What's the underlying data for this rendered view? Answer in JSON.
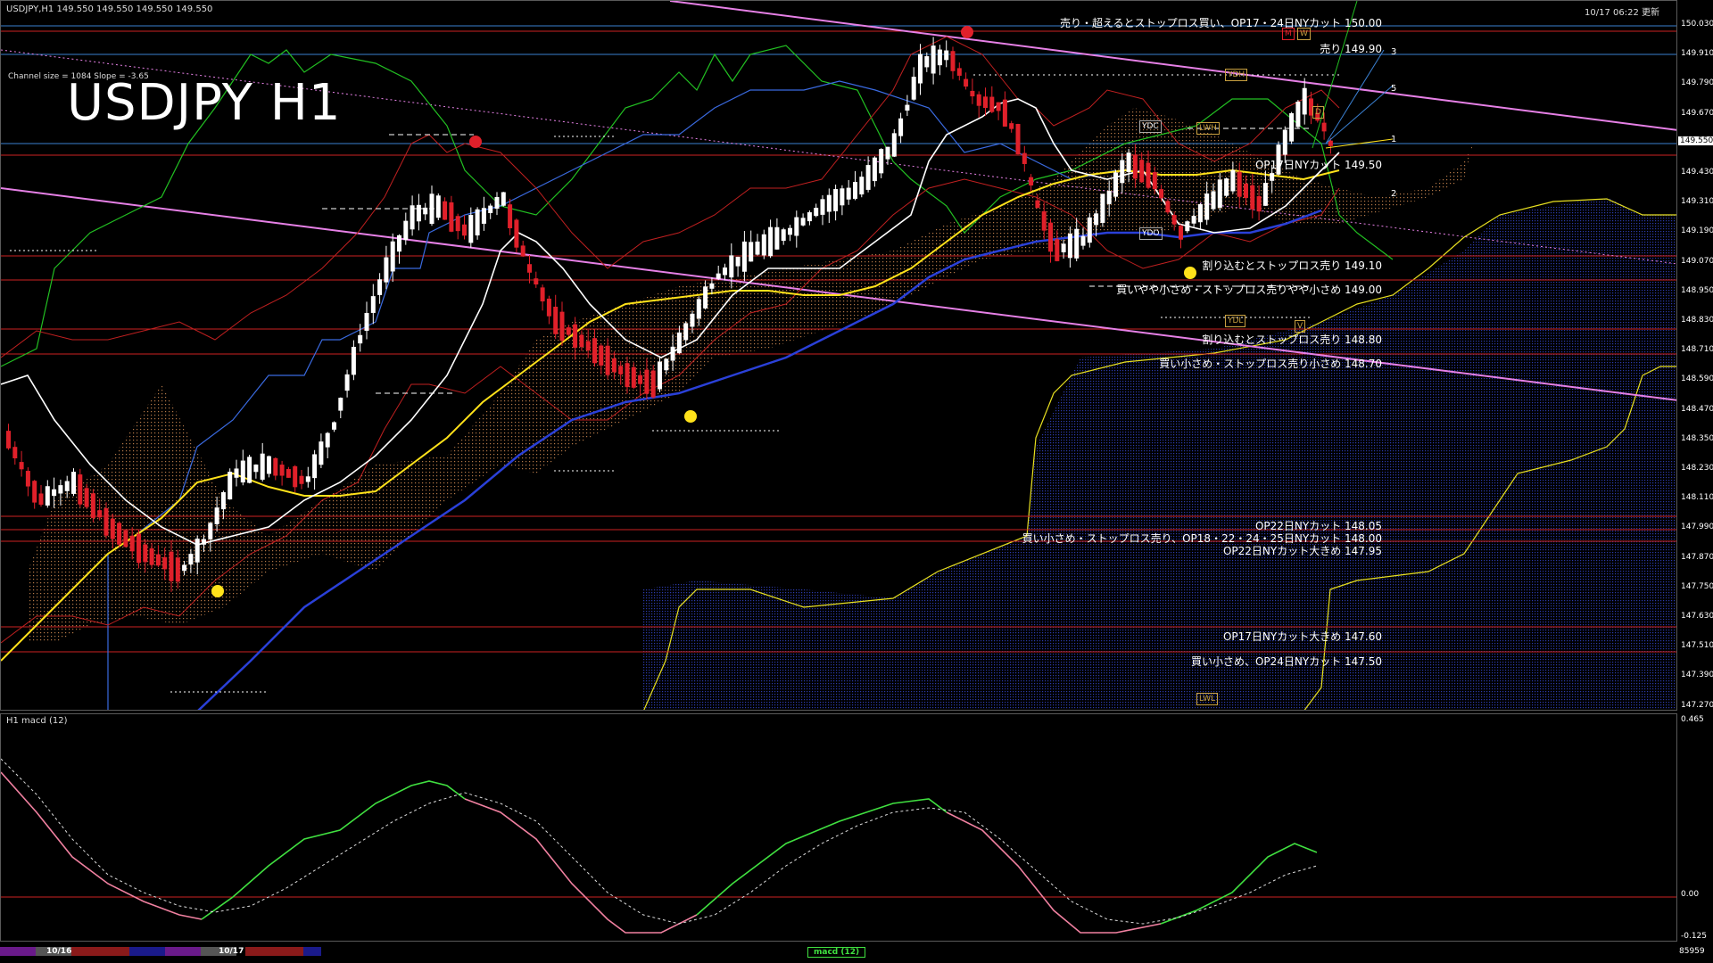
{
  "header": {
    "symbol_line": "USDJPY,H1  149.550 149.550 149.550 149.550",
    "datetime": "10/17 06:22 更新",
    "channel_info": "Channel size = 1084 Slope = -3.65",
    "title": "USDJPY H1"
  },
  "macd_panel": {
    "label": "H1  macd (12)",
    "axis": [
      "0.465",
      "0.00",
      "-0.125"
    ],
    "volume": "85959"
  },
  "price_axis": [
    "150.030",
    "149.910",
    "149.790",
    "149.670",
    "149.550",
    "149.430",
    "149.310",
    "149.190",
    "149.070",
    "148.950",
    "148.830",
    "148.710",
    "148.590",
    "148.470",
    "148.350",
    "148.230",
    "148.110",
    "147.990",
    "147.870",
    "147.750",
    "147.630",
    "147.510",
    "147.390",
    "147.270"
  ],
  "current_price": "149.550",
  "annotations": [
    "売り・超えるとストップロス買い、OP17・24日NYカット 150.00",
    "売り 149.90",
    "OP17日NYカット 149.50",
    "割り込むとストップロス売り 149.10",
    "買いやや小さめ・ストップロス売りやや小さめ 149.00",
    "割り込むとストップロス売り 148.80",
    "買い小さめ・ストップロス売り小さめ 148.70",
    "OP22日NYカット 148.05",
    "買い小さめ・ストップロス売り、OP18・22・24・25日NYカット 148.00",
    "OP22日NYカット大きめ 147.95",
    "OP17日NYカット大きめ 147.60",
    "買い小さめ、OP24日NYカット 147.50"
  ],
  "level_tags": {
    "ydh": "YDH",
    "ydc": "YDC",
    "lwh": "LWH",
    "ydo": "YDO",
    "ydl": "YDL",
    "lwl": "LWL",
    "m": "M",
    "w": "W",
    "d": "D",
    "v": "V"
  },
  "wave_labels": [
    "3",
    "5",
    "1",
    "2"
  ],
  "timebar": {
    "date1": "10/16",
    "date2": "10/17",
    "macd_tag": "macd (12)"
  },
  "colors": {
    "background": "#000000",
    "bull_candle": "#ffffff",
    "bear_candle": "#e0202a",
    "level_red": "#cc2222",
    "level_blue": "#3a7fd0",
    "channel": "#e680e6",
    "ma_fast": "#ffffff",
    "ma_mid": "#ffe21a",
    "ma_slow": "#2a40d8",
    "ichimoku_cloud": "#f0a060",
    "ichimoku_blue": "#3040c0",
    "chikou": "#22c022",
    "macd_main": "#40e040",
    "macd_neg": "#f080a0",
    "macd_signal": "#dddddd"
  }
}
